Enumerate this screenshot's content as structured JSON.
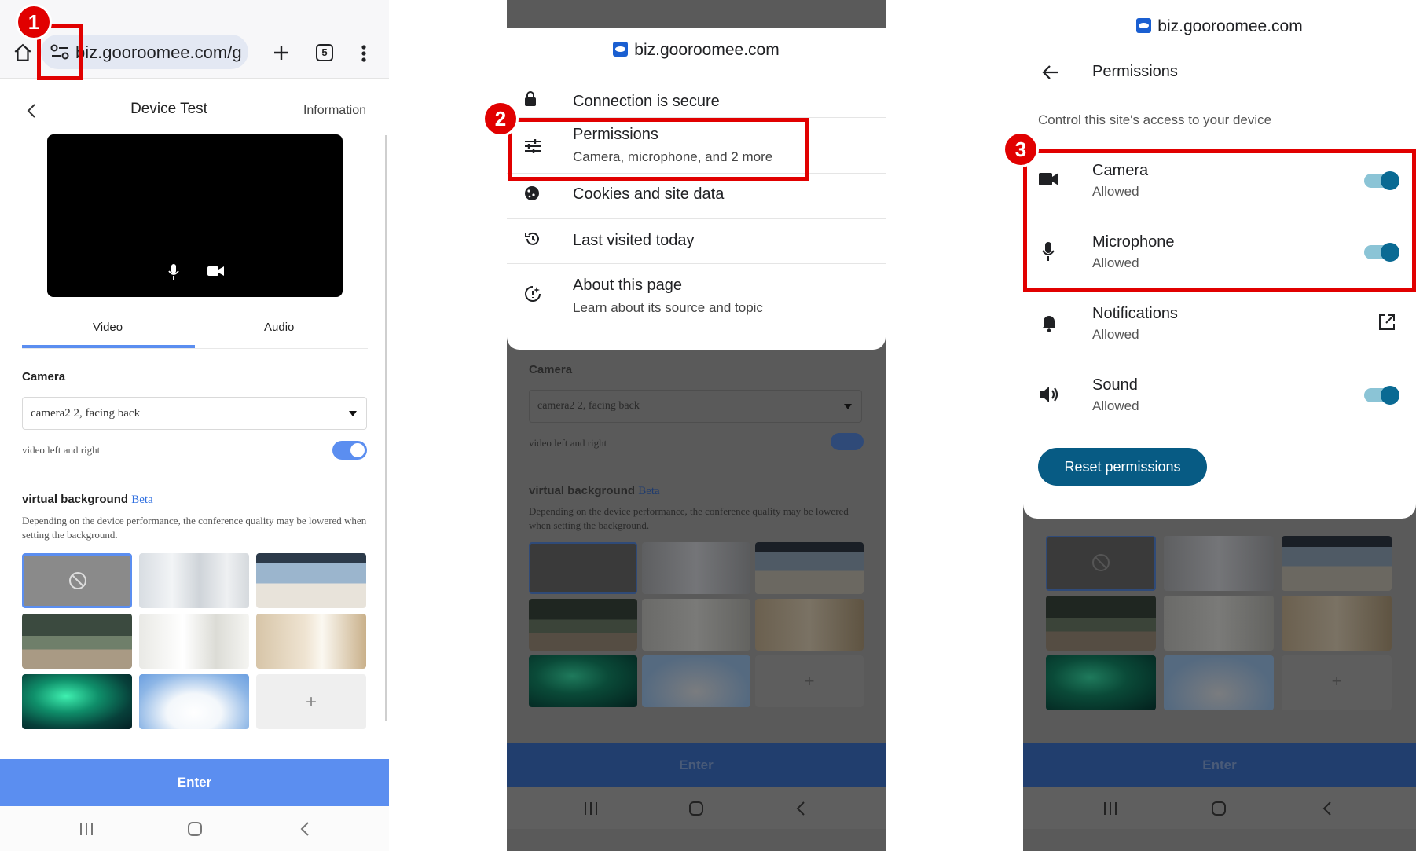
{
  "callouts": [
    "1",
    "2",
    "3"
  ],
  "panel1": {
    "browser": {
      "url": "biz.gooroomee.com/g",
      "tab_count": "5"
    },
    "header": {
      "title": "Device Test",
      "info_link": "Information"
    },
    "tabs": [
      {
        "label": "Video"
      },
      {
        "label": "Audio"
      }
    ],
    "camera": {
      "label": "Camera",
      "selected": "camera2 2, facing back",
      "mirror_label": "video left and right",
      "mirror_on": true
    },
    "virtual_bg": {
      "title": "virtual background",
      "beta": "Beta",
      "description": "Depending on the device performance, the conference quality may be lowered when setting the background.",
      "add_symbol": "+"
    },
    "enter_label": "Enter"
  },
  "panel2": {
    "site": "biz.gooroomee.com",
    "menu": [
      {
        "title": "Connection is secure",
        "icon": "lock-icon"
      },
      {
        "title": "Permissions",
        "subtitle": "Camera, microphone, and 2 more",
        "icon": "tune-icon"
      },
      {
        "title": "Cookies and site data",
        "icon": "cookie-icon"
      },
      {
        "title": "Last visited today",
        "icon": "history-icon"
      },
      {
        "title": "About this page",
        "subtitle": "Learn about its source and topic",
        "icon": "about-page-icon"
      }
    ],
    "bg": {
      "camera_label": "Camera",
      "selected": "camera2 2, facing back",
      "mirror_label": "video left and right",
      "vb_title": "virtual background",
      "beta": "Beta",
      "description": "Depending on the device performance, the conference quality may be lowered when setting the background.",
      "enter_label": "Enter",
      "add_symbol": "+"
    }
  },
  "panel3": {
    "site": "biz.gooroomee.com",
    "title": "Permissions",
    "subtitle": "Control this site's access to your device",
    "items": [
      {
        "title": "Camera",
        "status": "Allowed",
        "icon": "camera-icon",
        "control": "toggle",
        "on": true
      },
      {
        "title": "Microphone",
        "status": "Allowed",
        "icon": "microphone-icon",
        "control": "toggle",
        "on": true
      },
      {
        "title": "Notifications",
        "status": "Allowed",
        "icon": "bell-icon",
        "control": "open-external"
      },
      {
        "title": "Sound",
        "status": "Allowed",
        "icon": "speaker-icon",
        "control": "toggle",
        "on": true
      }
    ],
    "reset_label": "Reset permissions",
    "bg": {
      "enter_label": "Enter",
      "add_symbol": "+"
    }
  },
  "colors": {
    "callout": "#e10000",
    "accent_blue": "#5b8ef0",
    "toggle_teal": "#0a6a93",
    "reset_button": "#075b84"
  }
}
